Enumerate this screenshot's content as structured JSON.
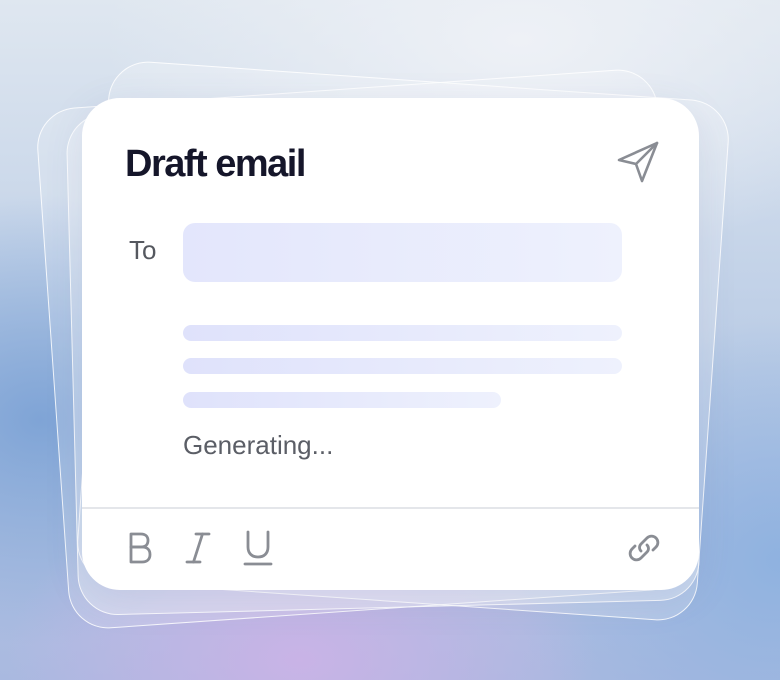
{
  "compose": {
    "title": "Draft email",
    "to_label": "To",
    "to_value": "",
    "status": "Generating..."
  },
  "icons": {
    "send": "paper-plane-icon",
    "bold": "bold-icon",
    "italic": "italic-icon",
    "underline": "underline-icon",
    "link": "link-icon"
  },
  "colors": {
    "title": "#15162a",
    "icon": "#8a8d94",
    "skeleton": "#e3e6fc"
  }
}
